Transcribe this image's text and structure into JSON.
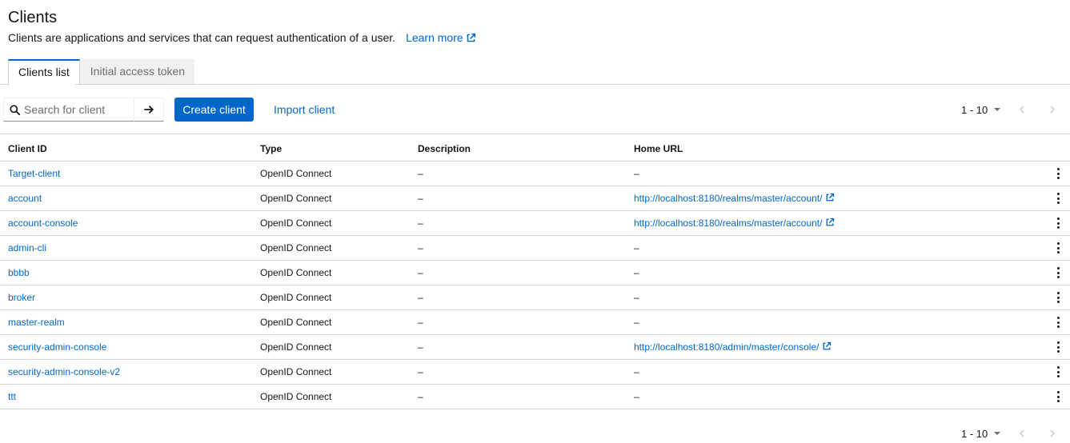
{
  "header": {
    "title": "Clients",
    "subtitle": "Clients are applications and services that can request authentication of a user.",
    "learn_more": "Learn more"
  },
  "tabs": [
    {
      "label": "Clients list",
      "active": true
    },
    {
      "label": "Initial access token",
      "active": false
    }
  ],
  "toolbar": {
    "search_placeholder": "Search for client",
    "search_value": "",
    "create_label": "Create client",
    "import_label": "Import client"
  },
  "pagination": {
    "top_range": "1 - 10",
    "bottom_range": "1 - 10"
  },
  "colors": {
    "accent": "#0066cc",
    "border": "#d2d2d2",
    "text": "#151515"
  },
  "icons": {
    "search": "search-icon",
    "submit": "arrow-right-icon",
    "external": "external-link-icon",
    "kebab": "kebab-icon",
    "prev": "angle-left-icon",
    "next": "angle-right-icon"
  },
  "table": {
    "columns": [
      "Client ID",
      "Type",
      "Description",
      "Home URL"
    ],
    "rows": [
      {
        "client_id": "Target-client",
        "type": "OpenID Connect",
        "description": "–",
        "home_url": "–",
        "url_is_link": false
      },
      {
        "client_id": "account",
        "type": "OpenID Connect",
        "description": "–",
        "home_url": "http://localhost:8180/realms/master/account/",
        "url_is_link": true
      },
      {
        "client_id": "account-console",
        "type": "OpenID Connect",
        "description": "–",
        "home_url": "http://localhost:8180/realms/master/account/",
        "url_is_link": true
      },
      {
        "client_id": "admin-cli",
        "type": "OpenID Connect",
        "description": "–",
        "home_url": "–",
        "url_is_link": false
      },
      {
        "client_id": "bbbb",
        "type": "OpenID Connect",
        "description": "–",
        "home_url": "–",
        "url_is_link": false
      },
      {
        "client_id": "broker",
        "type": "OpenID Connect",
        "description": "–",
        "home_url": "–",
        "url_is_link": false
      },
      {
        "client_id": "master-realm",
        "type": "OpenID Connect",
        "description": "–",
        "home_url": "–",
        "url_is_link": false
      },
      {
        "client_id": "security-admin-console",
        "type": "OpenID Connect",
        "description": "–",
        "home_url": "http://localhost:8180/admin/master/console/",
        "url_is_link": true
      },
      {
        "client_id": "security-admin-console-v2",
        "type": "OpenID Connect",
        "description": "–",
        "home_url": "–",
        "url_is_link": false
      },
      {
        "client_id": "ttt",
        "type": "OpenID Connect",
        "description": "–",
        "home_url": "–",
        "url_is_link": false
      }
    ]
  }
}
